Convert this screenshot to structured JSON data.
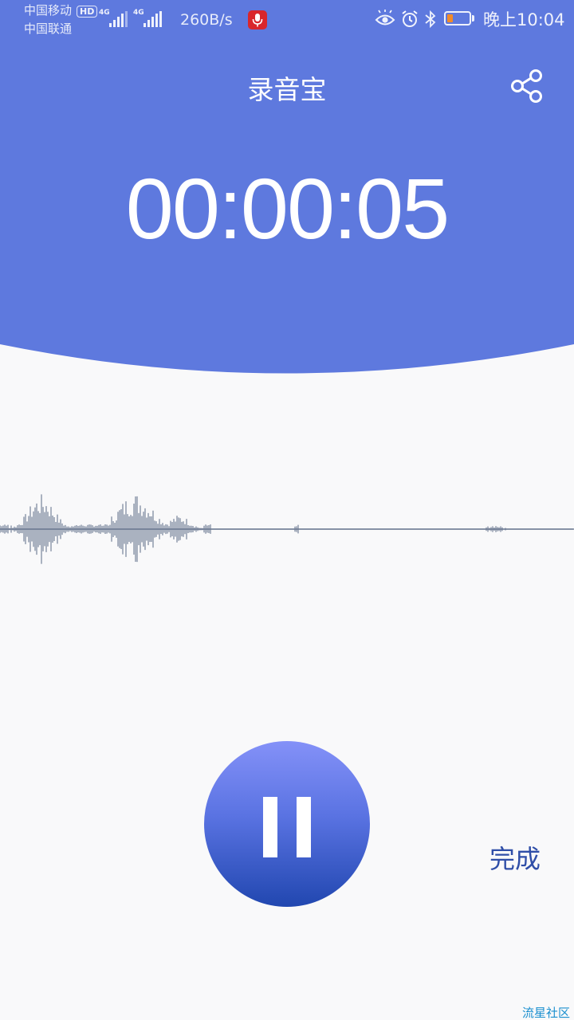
{
  "status_bar": {
    "carrier_1": "中国移动",
    "carrier_2": "中国联通",
    "hd_badge": "HD",
    "network_1": "4G",
    "network_2": "4G",
    "net_speed": "260B/s",
    "time": "晚上10:04",
    "battery_percent": 25,
    "battery_color": "#f28b29",
    "recording_indicator_color": "#d9262c",
    "icons": [
      "microphone-icon",
      "eye-icon",
      "alarm-icon",
      "bluetooth-icon",
      "battery-icon"
    ]
  },
  "toolbar": {
    "title": "录音宝",
    "share_icon": "share-icon"
  },
  "recorder": {
    "elapsed": "00:00:05",
    "pause_icon": "pause-icon",
    "done_label": "完成"
  },
  "colors": {
    "header": "#5e79de",
    "background": "#f9f9fa",
    "waveform": "#5b6a85",
    "accent_text": "#2f4ea8"
  },
  "watermark": "流星社区"
}
